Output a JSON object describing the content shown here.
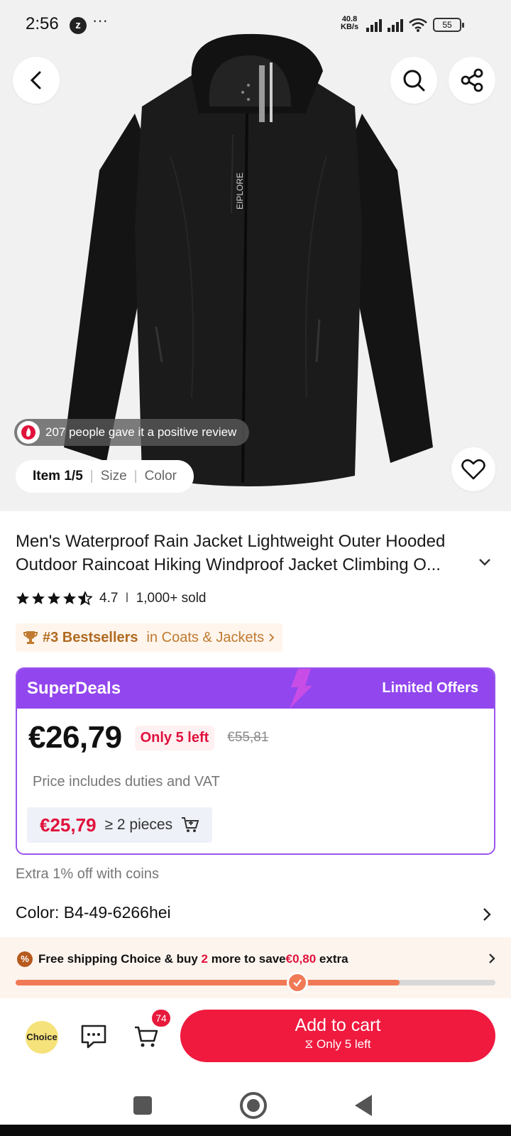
{
  "status_bar": {
    "time": "2:56",
    "mode_icon": "z-mode-icon",
    "more": "···",
    "speed_value": "40.8",
    "speed_unit": "KB/s",
    "battery": "55"
  },
  "product": {
    "image_icon": "black-jacket-image",
    "image_position": "Item 1/5",
    "option_size": "Size",
    "option_color": "Color",
    "review_note": "207 people gave it a positive review",
    "title": "Men's Waterproof Rain Jacket Lightweight Outer Hooded Outdoor Raincoat Hiking Windproof Jacket Climbing O...",
    "rating": "4.7",
    "rating_sep": "I",
    "sold": "1,000+ sold",
    "rank_label": "#3 Bestsellers",
    "rank_category": "in Coats & Jackets",
    "coins_note": "Extra 1% off with coins",
    "color_label": "Color: B4-49-6266hei"
  },
  "superdeals": {
    "title": "SuperDeals",
    "offer_label": "Limited Offers",
    "price": "€26,79",
    "stock": "Only 5 left",
    "old_price": "€55,81",
    "tax_note": "Price includes duties and VAT",
    "bulk_price": "€25,79",
    "bulk_qty": "≥ 2 pieces"
  },
  "shipping": {
    "part1": "Free shipping Choice & buy",
    "count": "2",
    "part2": "more to save",
    "amount": "€0,80",
    "part3": "extra",
    "progress_fraction": 0.8
  },
  "bottom_bar": {
    "choice_label": "Choice",
    "cart_count": "74",
    "add_to_cart": "Add to cart",
    "add_sub": "⧖ Only 5 left"
  },
  "colors": {
    "accent_red": "#f0193e",
    "deals_purple": "#9246ee",
    "rank_brown": "#b06a20",
    "shipping_orange": "#f07a55"
  }
}
